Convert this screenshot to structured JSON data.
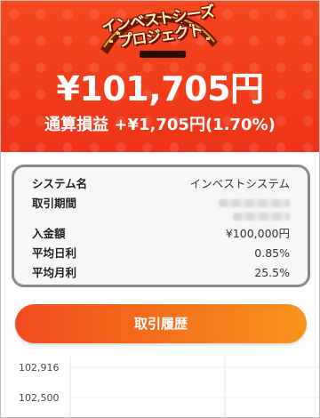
{
  "header": {
    "logo_text": "インベストシーズ",
    "logo_text_2": "プロジェクト",
    "balance": "¥101,705円",
    "pnl": "通算損益 +¥1,705円(1.70%)"
  },
  "info": {
    "system_name_label": "システム名",
    "system_name_value": "インベストシステム",
    "period_label": "取引期間",
    "deposit_label": "入金額",
    "deposit_value": "¥100,000円",
    "daily_label": "平均日利",
    "daily_value": "0.85%",
    "monthly_label": "平均月利",
    "monthly_value": "25.5%"
  },
  "history_button": "取引履歴",
  "chart_data": {
    "type": "line",
    "y_ticks": [
      "102,916",
      "102,500"
    ],
    "ylim": [
      102500,
      102916
    ],
    "grid": true,
    "series": []
  },
  "colors": {
    "hero_red": "#f33a1c",
    "button_start": "#f24b1c",
    "button_end": "#f7941d",
    "card_border": "#8a8a8a"
  }
}
